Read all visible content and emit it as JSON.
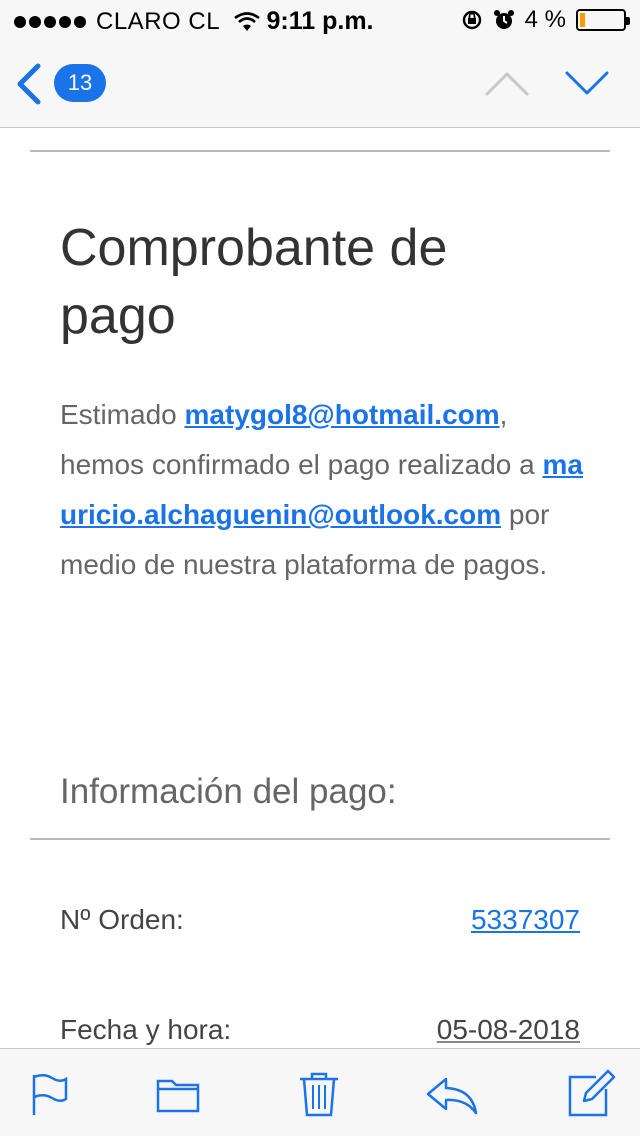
{
  "status_bar": {
    "carrier": "CLARO CL",
    "time": "9:11 p.m.",
    "battery_text": "4 %",
    "battery_level": 0.04
  },
  "nav": {
    "unread_count": "13"
  },
  "email": {
    "title": "Comprobante de pago",
    "greeting": "Estimado ",
    "sender_email": "matygol8@hotmail.com",
    "after_sender": ",",
    "confirm_text": " hemos confirmado el pago realizado a ",
    "recipient_email": "mauricio.alchaguenin@outlook.com",
    "after_recipient": " por medio de nuestra plataforma de pagos.",
    "section_title": "Información del pago:",
    "order_label": "Nº Orden:",
    "order_value": "5337307",
    "date_label": "Fecha y hora:",
    "date_value": "05-08-2018"
  },
  "colors": {
    "accent": "#1a73e8",
    "battery_low": "#ff9a00"
  },
  "icons": [
    "back-chevron-icon",
    "chevron-up-icon",
    "chevron-down-icon",
    "flag-icon",
    "folder-icon",
    "trash-icon",
    "reply-icon",
    "compose-icon"
  ]
}
